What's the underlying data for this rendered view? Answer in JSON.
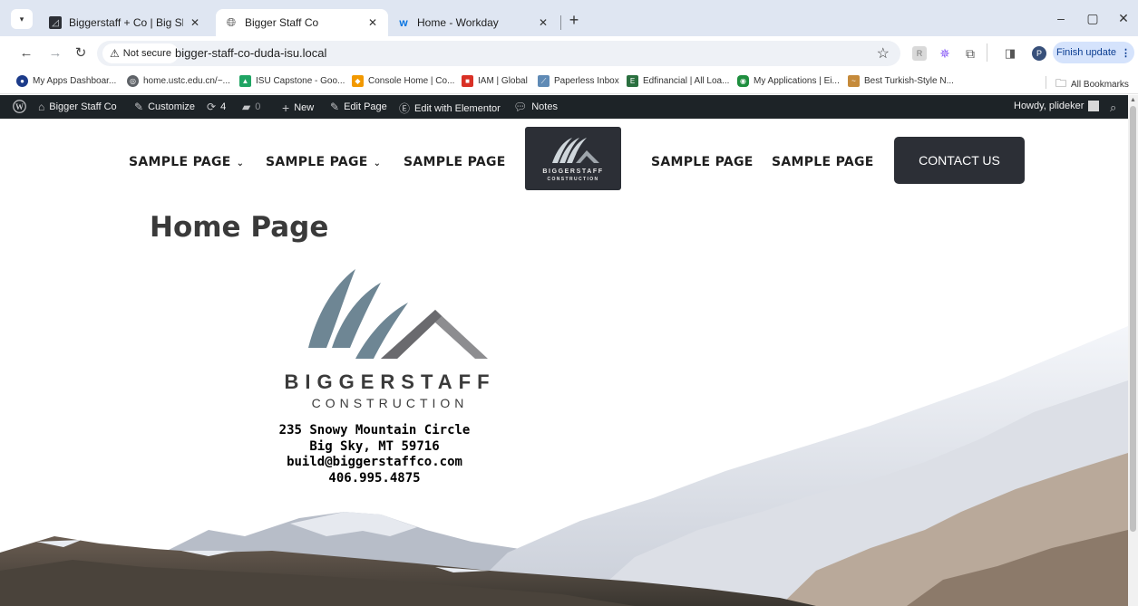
{
  "browser": {
    "tabs": [
      {
        "title": "Biggerstaff + Co | Big Sky Mont",
        "active": false
      },
      {
        "title": "Bigger Staff Co",
        "active": true
      },
      {
        "title": "Home - Workday",
        "active": false
      }
    ],
    "new_tab": "+",
    "window_controls": {
      "minimize": "–",
      "restore": "▢",
      "close": "✕"
    },
    "address": {
      "security_label": "Not secure",
      "url": "bigger-staff-co-duda-isu.local"
    },
    "profile_initial": "P",
    "finish_update_label": "Finish update"
  },
  "bookmarks": {
    "items": [
      {
        "label": "My Apps Dashboar...",
        "color": "#1c3b8a"
      },
      {
        "label": "home.ustc.edu.cn/~...",
        "color": "#5f6368"
      },
      {
        "label": "ISU Capstone - Goo...",
        "color": "#1fa463"
      },
      {
        "label": "Console Home | Co...",
        "color": "#f29900"
      },
      {
        "label": "IAM | Global",
        "color": "#d93025"
      },
      {
        "label": "Paperless Inbox",
        "color": "#5f8ab5"
      },
      {
        "label": "Edfinancial | All Loa...",
        "color": "#2a6f3f"
      },
      {
        "label": "My Applications | Ei...",
        "color": "#1e8e3e"
      },
      {
        "label": "Best Turkish-Style N...",
        "color": "#c58a3a"
      }
    ],
    "all_bookmarks_label": "All Bookmarks"
  },
  "admin_bar": {
    "site_name": "Bigger Staff Co",
    "customize": "Customize",
    "updates_count": "4",
    "comments_count": "0",
    "new": "New",
    "edit_page": "Edit Page",
    "edit_elementor": "Edit with Elementor",
    "notes": "Notes",
    "greeting": "Howdy, plideker"
  },
  "site_nav": {
    "left_items": [
      {
        "label": "SAMPLE PAGE",
        "has_dropdown": true
      },
      {
        "label": "SAMPLE PAGE",
        "has_dropdown": true
      },
      {
        "label": "SAMPLE PAGE",
        "has_dropdown": false
      }
    ],
    "right_items": [
      {
        "label": "SAMPLE PAGE"
      },
      {
        "label": "SAMPLE PAGE"
      }
    ],
    "logo": {
      "line1": "BIGGERSTAFF",
      "line2": "CONSTRUCTION"
    },
    "contact_label": "CONTACT US"
  },
  "page": {
    "title": "Home Page",
    "brand": {
      "line1": "BIGGERSTAFF",
      "line2": "CONSTRUCTION"
    },
    "address_lines": [
      "235 Snowy Mountain Circle",
      "Big Sky, MT 59716",
      "build@biggerstaffco.com",
      "406.995.4875"
    ]
  },
  "colors": {
    "nav_dark": "#2c2f36",
    "admin_bar": "#1d2327",
    "logo_blue": "#6e8694",
    "logo_gray": "#8d8d90"
  }
}
